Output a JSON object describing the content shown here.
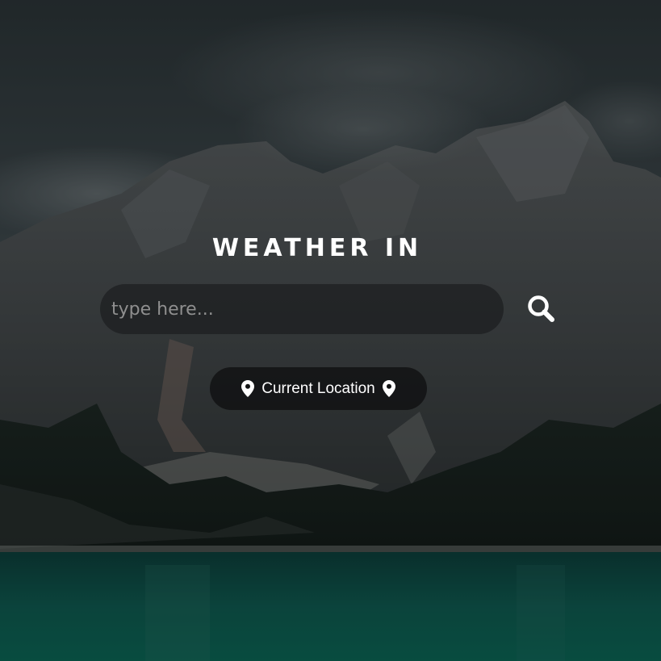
{
  "page": {
    "title": "WEATHER IN"
  },
  "search": {
    "placeholder": "type here...",
    "value": "",
    "button_icon": "search-icon"
  },
  "location": {
    "label": "Current Location",
    "icon_left": "map-pin-icon",
    "icon_right": "map-pin-icon"
  },
  "background": {
    "subject": "mountain-lake-photo",
    "sky_color": "#3a4448",
    "mountain_color": "#4a4f51",
    "lake_color": "#0f5a50"
  }
}
